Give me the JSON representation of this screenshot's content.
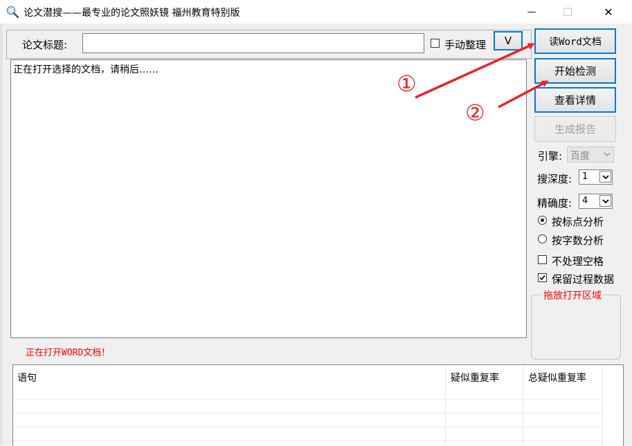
{
  "window": {
    "title": "论文潜搜——最专业的论文照妖镜 福州教育特别版",
    "minimize": "—",
    "maximize": "☐",
    "close": "✕"
  },
  "top": {
    "title_label": "论文标题:",
    "title_value": "",
    "manual_label": "手动整理",
    "manual_checked": false,
    "v_button": "V"
  },
  "main": {
    "log_text": "正在打开选择的文档，请稍后……",
    "status": "正在打开WORD文档！"
  },
  "buttons": {
    "read_word": "读Word文档",
    "start_check": "开始检测",
    "view_detail": "查看详情",
    "gen_report": "生成报告"
  },
  "settings": {
    "engine_label": "引擎:",
    "engine_value": "百度",
    "depth_label": "搜深度:",
    "depth_value": "1",
    "precision_label": "精确度:",
    "precision_value": "4",
    "radio_punct": "按标点分析",
    "radio_count": "按字数分析",
    "no_space_label": "不处理空格",
    "keep_data_label": "保留过程数据",
    "drop_area_label": "拖放打开区域"
  },
  "table": {
    "columns": [
      "语句",
      "疑似重复率",
      "总疑似重复率"
    ],
    "rows": []
  },
  "annotations": {
    "circle_1": "①",
    "circle_2": "②"
  },
  "colors": {
    "accent": "#0078d7",
    "status_red": "#ff0000",
    "annotation_red": "#ee2222"
  }
}
